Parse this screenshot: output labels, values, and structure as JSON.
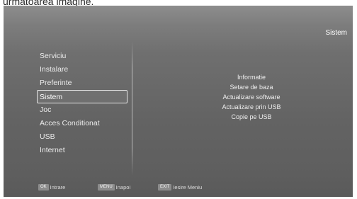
{
  "caption": "urmatoarea imagine.",
  "header": {
    "title": "Sistem"
  },
  "main_menu": {
    "items": [
      {
        "label": "Serviciu"
      },
      {
        "label": "Instalare"
      },
      {
        "label": "Preferinte"
      },
      {
        "label": "Sistem",
        "selected": true
      },
      {
        "label": "Joc"
      },
      {
        "label": "Acces Conditionat"
      },
      {
        "label": "USB"
      },
      {
        "label": "Internet"
      }
    ]
  },
  "sub_menu": {
    "items": [
      {
        "label": "Informatie"
      },
      {
        "label": "Setare de baza"
      },
      {
        "label": "Actualizare software"
      },
      {
        "label": "Actualizare prin USB"
      },
      {
        "label": "Copie pe USB"
      }
    ]
  },
  "footer": {
    "hints": [
      {
        "key": "OK",
        "label": "Intrare"
      },
      {
        "key": "MENU",
        "label": "Inapoi"
      },
      {
        "key": "EXIT",
        "label": "Iesire Meniu"
      }
    ]
  }
}
